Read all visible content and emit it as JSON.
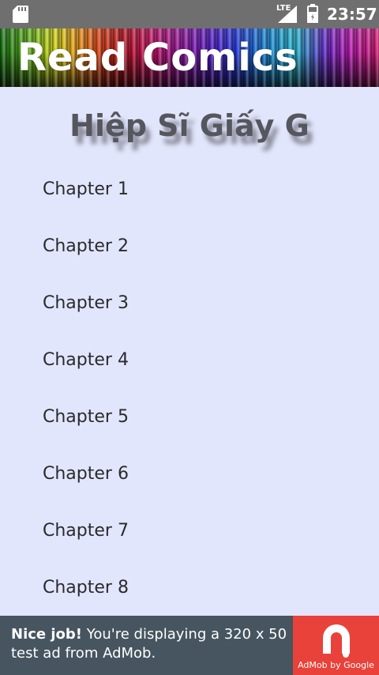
{
  "status_bar": {
    "network": "LTE",
    "time": "23:57",
    "icons": [
      "sd-card-icon",
      "signal-icon",
      "battery-icon"
    ]
  },
  "banner": {
    "title": "Read Comics"
  },
  "comic": {
    "title": "Hiệp Sĩ Giấy G"
  },
  "chapters": [
    {
      "label": "Chapter 1"
    },
    {
      "label": "Chapter 2"
    },
    {
      "label": "Chapter 3"
    },
    {
      "label": "Chapter 4"
    },
    {
      "label": "Chapter 5"
    },
    {
      "label": "Chapter 6"
    },
    {
      "label": "Chapter 7"
    },
    {
      "label": "Chapter 8"
    }
  ],
  "ad": {
    "headline": "Nice job!",
    "body": " You're displaying a 320 x 50 test ad from AdMob.",
    "brand": "AdMob by Google"
  },
  "colors": {
    "background": "#e2e6fc",
    "status_bar": "#6f6f6f",
    "ad_background": "#46555f",
    "ad_logo": "#e8423a",
    "title_text": "#55565e"
  }
}
